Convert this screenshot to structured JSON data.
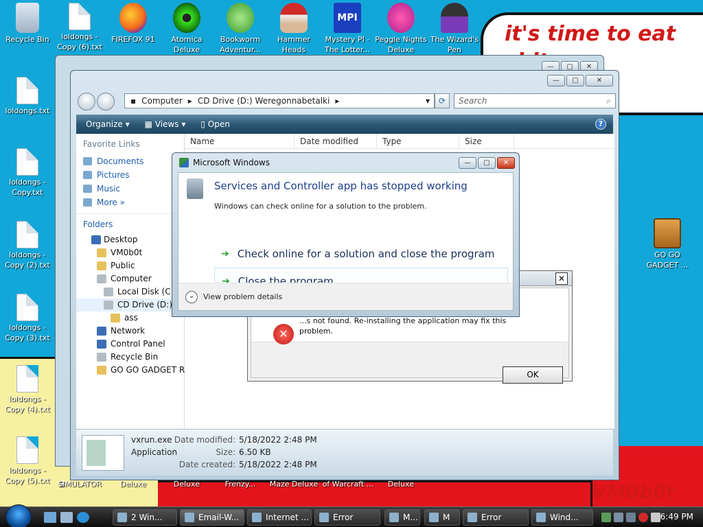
{
  "wallpaper": {
    "speech": "it's time to eat shit\nand chew\nm",
    "signature": "VM0b0t"
  },
  "desktop_icons": [
    {
      "label": "Recycle Bin",
      "icon": "recycle-bin-icon"
    },
    {
      "label": "loldongs - Copy (6).txt",
      "icon": "text-file-icon"
    },
    {
      "label": "FIREFOX 91",
      "icon": "firefox-icon"
    },
    {
      "label": "Atomica Deluxe",
      "icon": "atomica-icon"
    },
    {
      "label": "Bookworm Adventur...",
      "icon": "bookworm-icon"
    },
    {
      "label": "Hammer Heads Deluxe",
      "icon": "hammerheads-icon"
    },
    {
      "label": "Mystery PI - The Lotter...",
      "icon": "mystery-pi-icon"
    },
    {
      "label": "Peggle Nights Deluxe",
      "icon": "peggle-icon"
    },
    {
      "label": "The Wizard's Pen",
      "icon": "wizard-pen-icon"
    },
    {
      "label": "loldongs.txt",
      "icon": "text-file-icon"
    },
    {
      "label": "loldongs - Copy.txt",
      "icon": "text-file-icon"
    },
    {
      "label": "loldongs - Copy (2).txt",
      "icon": "text-file-icon"
    },
    {
      "label": "loldongs - Copy (3).txt",
      "icon": "text-file-icon"
    },
    {
      "label": "loldongs - Copy (4).txt",
      "icon": "text-file-icon"
    },
    {
      "label": "loldongs - Copy (5).txt",
      "icon": "text-file-icon"
    },
    {
      "label": "GO GO GADGET ...",
      "icon": "briefcase-icon"
    }
  ],
  "bottom_labels": [
    "B",
    "SIMULATOR",
    "Deluxe",
    "Deluxe",
    "Frenzy...",
    "Maze Deluxe",
    "of Warcraft ...",
    "Deluxe"
  ],
  "explorer": {
    "address": [
      "Computer",
      "CD Drive (D:) Weregonnabetalki"
    ],
    "search_placeholder": "Search",
    "toolbar": {
      "organize": "Organize",
      "views": "Views",
      "open": "Open",
      "help": "?"
    },
    "favorite_links_header": "Favorite Links",
    "favorites": [
      "Documents",
      "Pictures",
      "Music",
      "More"
    ],
    "folders_header": "Folders",
    "tree": [
      "Desktop",
      "VM0b0t",
      "Public",
      "Computer",
      "Local Disk (C:)",
      "CD Drive (D:) We",
      "ass",
      "Network",
      "Control Panel",
      "Recycle Bin",
      "GO GO GADGET RAPI"
    ],
    "columns": [
      "Name",
      "Date modified",
      "Type",
      "Size"
    ],
    "details": {
      "name": "vxrun.exe",
      "type": "Application",
      "date_modified_label": "Date modified:",
      "date_modified": "5/18/2022 2:48 PM",
      "size_label": "Size:",
      "size": "6.50 KB",
      "date_created_label": "Date created:",
      "date_created": "5/18/2022 2:48 PM"
    },
    "left_letters": [
      "R",
      "F"
    ]
  },
  "crash_dialog": {
    "title": "Microsoft Windows",
    "heading": "Services and Controller app has stopped working",
    "subtext": "Windows can check online for a solution to the problem.",
    "option1": "Check online for a solution and close the program",
    "option2": "Close the program",
    "details": "View problem details"
  },
  "error_dialog": {
    "message": "...s not found. Re-installing the application may fix this problem.",
    "ok": "OK",
    "close": "✕"
  },
  "taskbar": {
    "buttons": [
      "2 Win...",
      "Email-W...",
      "Internet ...",
      "Error",
      "M...",
      "M",
      "Error",
      "Wind..."
    ],
    "clock": "6:49 PM"
  }
}
